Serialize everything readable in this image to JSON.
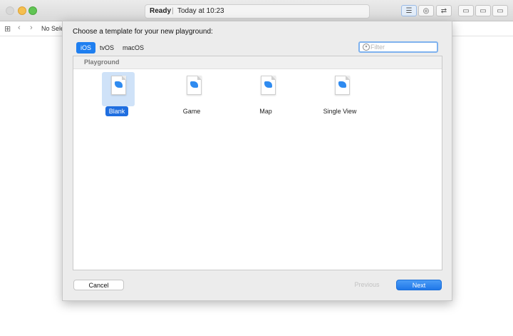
{
  "window": {
    "status": {
      "state": "Ready",
      "separator": "|",
      "time": "Today at 10:23"
    }
  },
  "navbar": {
    "selection_text": "No Sele"
  },
  "sheet": {
    "title": "Choose a template for your new playground:",
    "platforms": [
      {
        "label": "iOS",
        "selected": true
      },
      {
        "label": "tvOS",
        "selected": false
      },
      {
        "label": "macOS",
        "selected": false
      }
    ],
    "filter": {
      "placeholder": "Filter",
      "value": ""
    },
    "section": "Playground",
    "templates": [
      {
        "label": "Blank",
        "icon": "swift-doc-icon",
        "selected": true
      },
      {
        "label": "Game",
        "icon": "swift-doc-icon",
        "selected": false
      },
      {
        "label": "Map",
        "icon": "swift-doc-icon",
        "selected": false
      },
      {
        "label": "Single View",
        "icon": "swift-doc-icon",
        "selected": false
      }
    ],
    "buttons": {
      "cancel": "Cancel",
      "previous": "Previous",
      "next": "Next"
    }
  },
  "colors": {
    "accent": "#1f7ff0",
    "selection_bg": "#cfe2f8"
  }
}
